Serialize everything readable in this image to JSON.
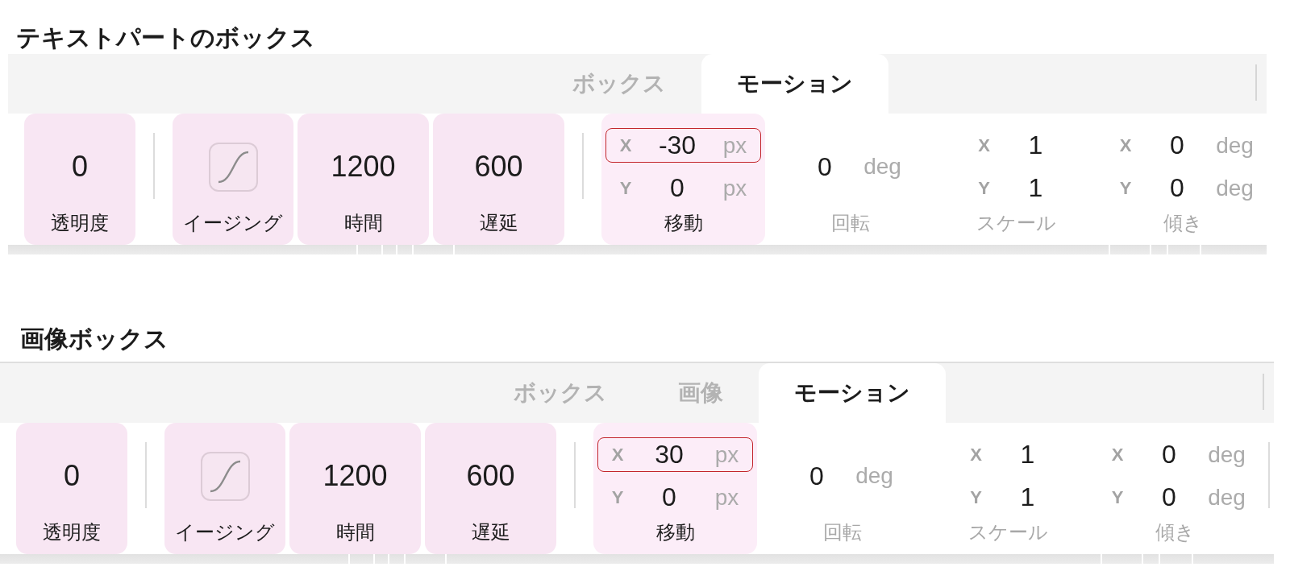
{
  "panels": [
    {
      "title": "テキストパートのボックス",
      "tabs": [
        {
          "label": "ボックス",
          "selected": false
        },
        {
          "label": "モーション",
          "selected": true
        }
      ],
      "trailing_divider": false,
      "groups": [
        {
          "controls": [
            {
              "kind": "number",
              "value": "0",
              "label": "透明度",
              "modified": true
            }
          ]
        },
        {
          "controls": [
            {
              "kind": "easing",
              "label": "イージング",
              "modified": true
            },
            {
              "kind": "number",
              "value": "1200",
              "label": "時間",
              "modified": true
            },
            {
              "kind": "number",
              "value": "600",
              "label": "遅延",
              "modified": true
            }
          ]
        },
        {
          "controls": [
            {
              "kind": "axes",
              "label": "移動",
              "modified": true,
              "rows": [
                {
                  "axis": "X",
                  "value": "-30",
                  "unit": "px",
                  "highlighted": true
                },
                {
                  "axis": "Y",
                  "value": "0",
                  "unit": "px",
                  "highlighted": false
                }
              ]
            },
            {
              "kind": "unit",
              "label": "回転",
              "modified": false,
              "value": "0",
              "unit": "deg"
            },
            {
              "kind": "axes",
              "label": "スケール",
              "modified": false,
              "rows": [
                {
                  "axis": "X",
                  "value": "1",
                  "highlighted": false
                },
                {
                  "axis": "Y",
                  "value": "1",
                  "highlighted": false
                }
              ]
            },
            {
              "kind": "axes",
              "label": "傾き",
              "modified": false,
              "rows": [
                {
                  "axis": "X",
                  "value": "0",
                  "unit": "deg",
                  "highlighted": false
                },
                {
                  "axis": "Y",
                  "value": "0",
                  "unit": "deg",
                  "highlighted": false
                }
              ]
            }
          ]
        }
      ]
    },
    {
      "title": "画像ボックス",
      "tabs": [
        {
          "label": "ボックス",
          "selected": false
        },
        {
          "label": "画像",
          "selected": false
        },
        {
          "label": "モーション",
          "selected": true
        }
      ],
      "trailing_divider": true,
      "groups": [
        {
          "controls": [
            {
              "kind": "number",
              "value": "0",
              "label": "透明度",
              "modified": true
            }
          ]
        },
        {
          "controls": [
            {
              "kind": "easing",
              "label": "イージング",
              "modified": true
            },
            {
              "kind": "number",
              "value": "1200",
              "label": "時間",
              "modified": true
            },
            {
              "kind": "number",
              "value": "600",
              "label": "遅延",
              "modified": true
            }
          ]
        },
        {
          "controls": [
            {
              "kind": "axes",
              "label": "移動",
              "modified": true,
              "rows": [
                {
                  "axis": "X",
                  "value": "30",
                  "unit": "px",
                  "highlighted": true
                },
                {
                  "axis": "Y",
                  "value": "0",
                  "unit": "px",
                  "highlighted": false
                }
              ]
            },
            {
              "kind": "unit",
              "label": "回転",
              "modified": false,
              "value": "0",
              "unit": "deg"
            },
            {
              "kind": "axes",
              "label": "スケール",
              "modified": false,
              "rows": [
                {
                  "axis": "X",
                  "value": "1",
                  "highlighted": false
                },
                {
                  "axis": "Y",
                  "value": "1",
                  "highlighted": false
                }
              ]
            },
            {
              "kind": "axes",
              "label": "傾き",
              "modified": false,
              "rows": [
                {
                  "axis": "X",
                  "value": "0",
                  "unit": "deg",
                  "highlighted": false
                },
                {
                  "axis": "Y",
                  "value": "0",
                  "unit": "deg",
                  "highlighted": false
                }
              ]
            }
          ]
        }
      ]
    }
  ]
}
